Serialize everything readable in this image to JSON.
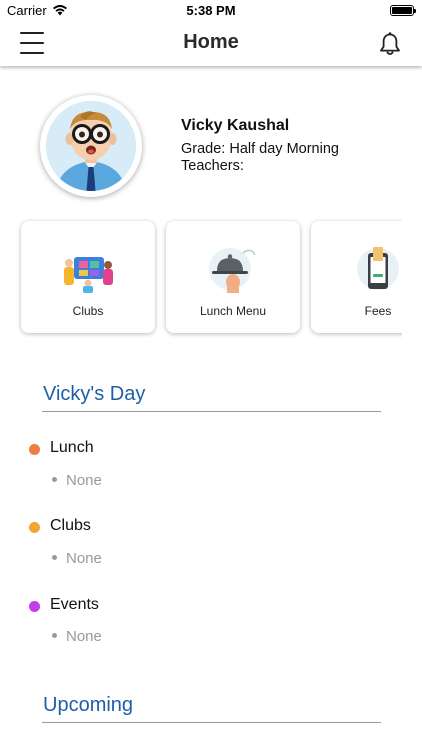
{
  "status_bar": {
    "carrier": "Carrier",
    "time": "5:38 PM"
  },
  "nav": {
    "title": "Home",
    "menu_icon": "hamburger-menu-icon",
    "bell_icon": "bell-icon"
  },
  "profile": {
    "name": "Vicky Kaushal",
    "grade": "Grade: Half day Morning",
    "teachers": "Teachers:"
  },
  "cards": [
    {
      "label": "Clubs",
      "icon": "clubs-icon"
    },
    {
      "label": "Lunch Menu",
      "icon": "lunch-menu-icon"
    },
    {
      "label": "Fees",
      "icon": "fees-icon"
    }
  ],
  "day": {
    "title": "Vicky's Day",
    "items": [
      {
        "label": "Lunch",
        "detail": "None",
        "color": "#ef7c45"
      },
      {
        "label": "Clubs",
        "detail": "None",
        "color": "#f3a431"
      },
      {
        "label": "Events",
        "detail": "None",
        "color": "#c13ee8"
      }
    ]
  },
  "upcoming": {
    "title": "Upcoming"
  },
  "colors": {
    "section_title": "#1f5ea8",
    "muted": "#9a9a9a"
  }
}
